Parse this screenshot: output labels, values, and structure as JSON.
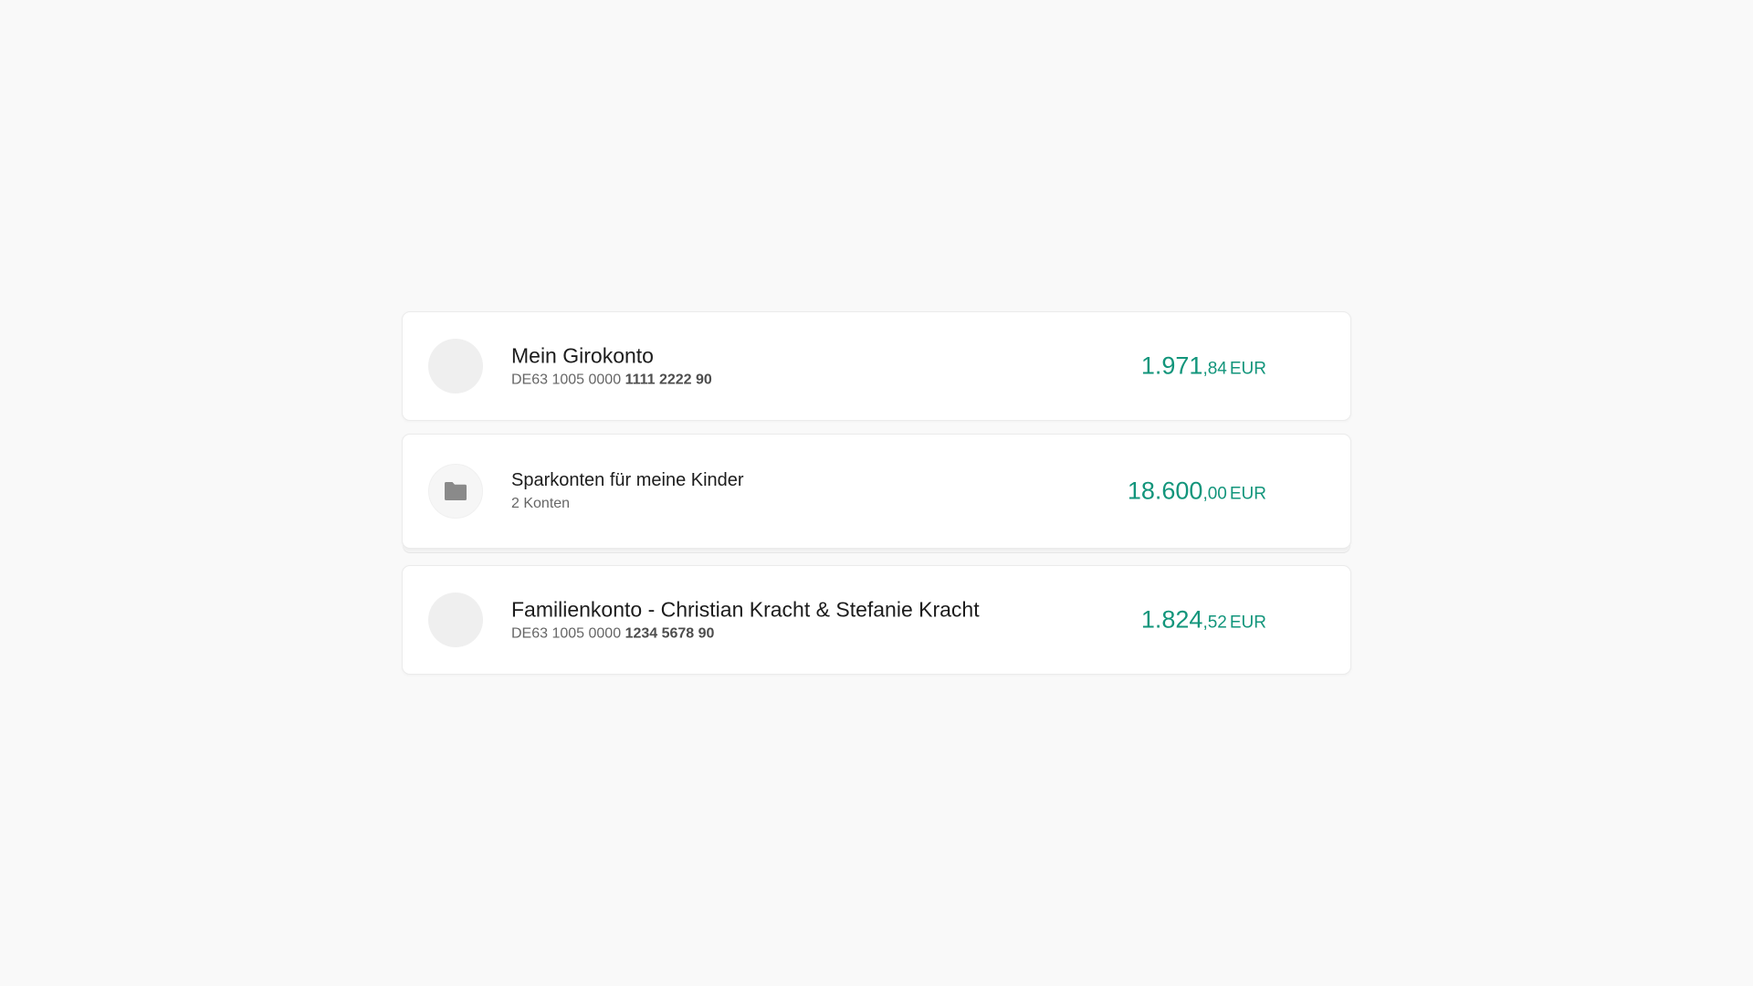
{
  "accounts": [
    {
      "name": "Mein Girokonto",
      "iban_prefix": "DE63 1005 0000",
      "iban_bold": "1111 2222 90",
      "balance_main": "1.971",
      "balance_cents": ",84",
      "currency": "EUR"
    },
    {
      "name": "Sparkonten für meine Kinder",
      "subtitle": "2 Konten",
      "balance_main": "18.600",
      "balance_cents": ",00",
      "currency": "EUR",
      "icon": "folder-icon"
    },
    {
      "name": "Familienkonto - Christian Kracht & Stefanie Kracht",
      "iban_prefix": "DE63 1005 0000",
      "iban_bold": "1234 5678 90",
      "balance_main": "1.824",
      "balance_cents": ",52",
      "currency": "EUR"
    }
  ],
  "colors": {
    "accent": "#12957b",
    "background": "#f9f9f9",
    "card": "#ffffff",
    "folder_icon": "#8a8a8a"
  }
}
